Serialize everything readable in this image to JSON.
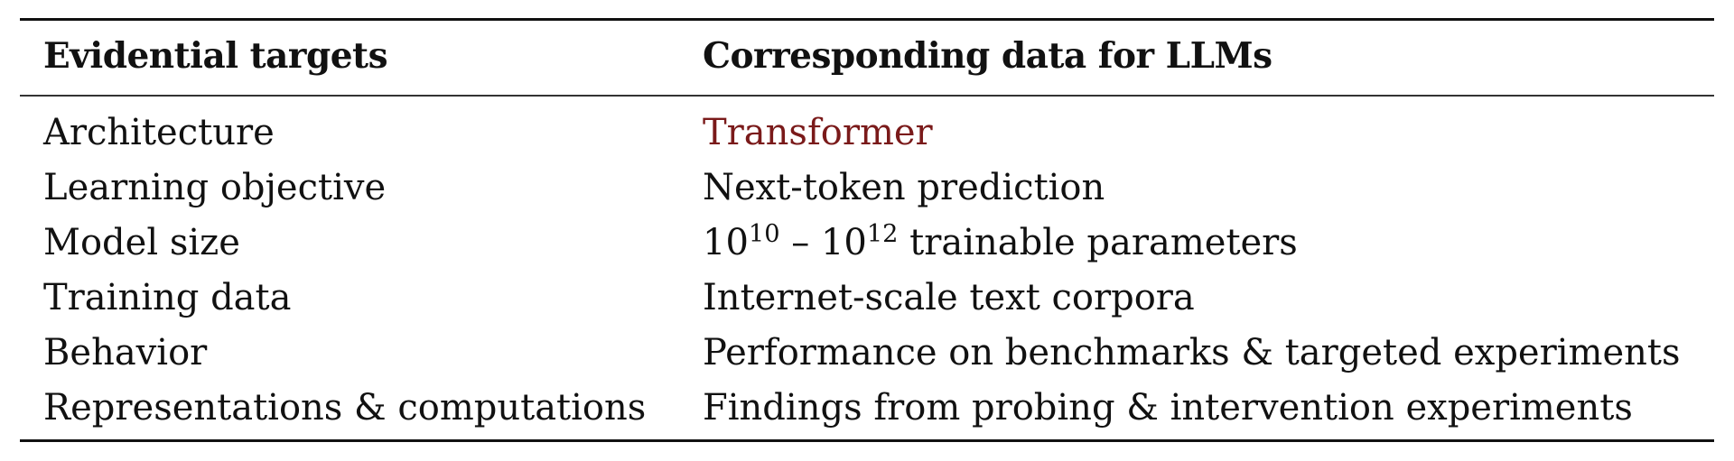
{
  "table": {
    "headers": [
      "Evidential targets",
      "Corresponding data for LLMs"
    ],
    "accent_color": "#7a1a1a",
    "rows": [
      {
        "target": "Architecture",
        "data": "Transformer",
        "accent": true
      },
      {
        "target": "Learning objective",
        "data": "Next-token prediction"
      },
      {
        "target": "Model size",
        "data_parts": {
          "base1": "10",
          "exp1": "10",
          "dash": " – ",
          "base2": "10",
          "exp2": "12",
          "rest": " trainable parameters"
        }
      },
      {
        "target": "Training data",
        "data": "Internet-scale text corpora"
      },
      {
        "target": "Behavior",
        "data": "Performance on benchmarks & targeted experiments"
      },
      {
        "target": "Representations & computations",
        "data": "Findings from probing & intervention experiments"
      }
    ]
  }
}
